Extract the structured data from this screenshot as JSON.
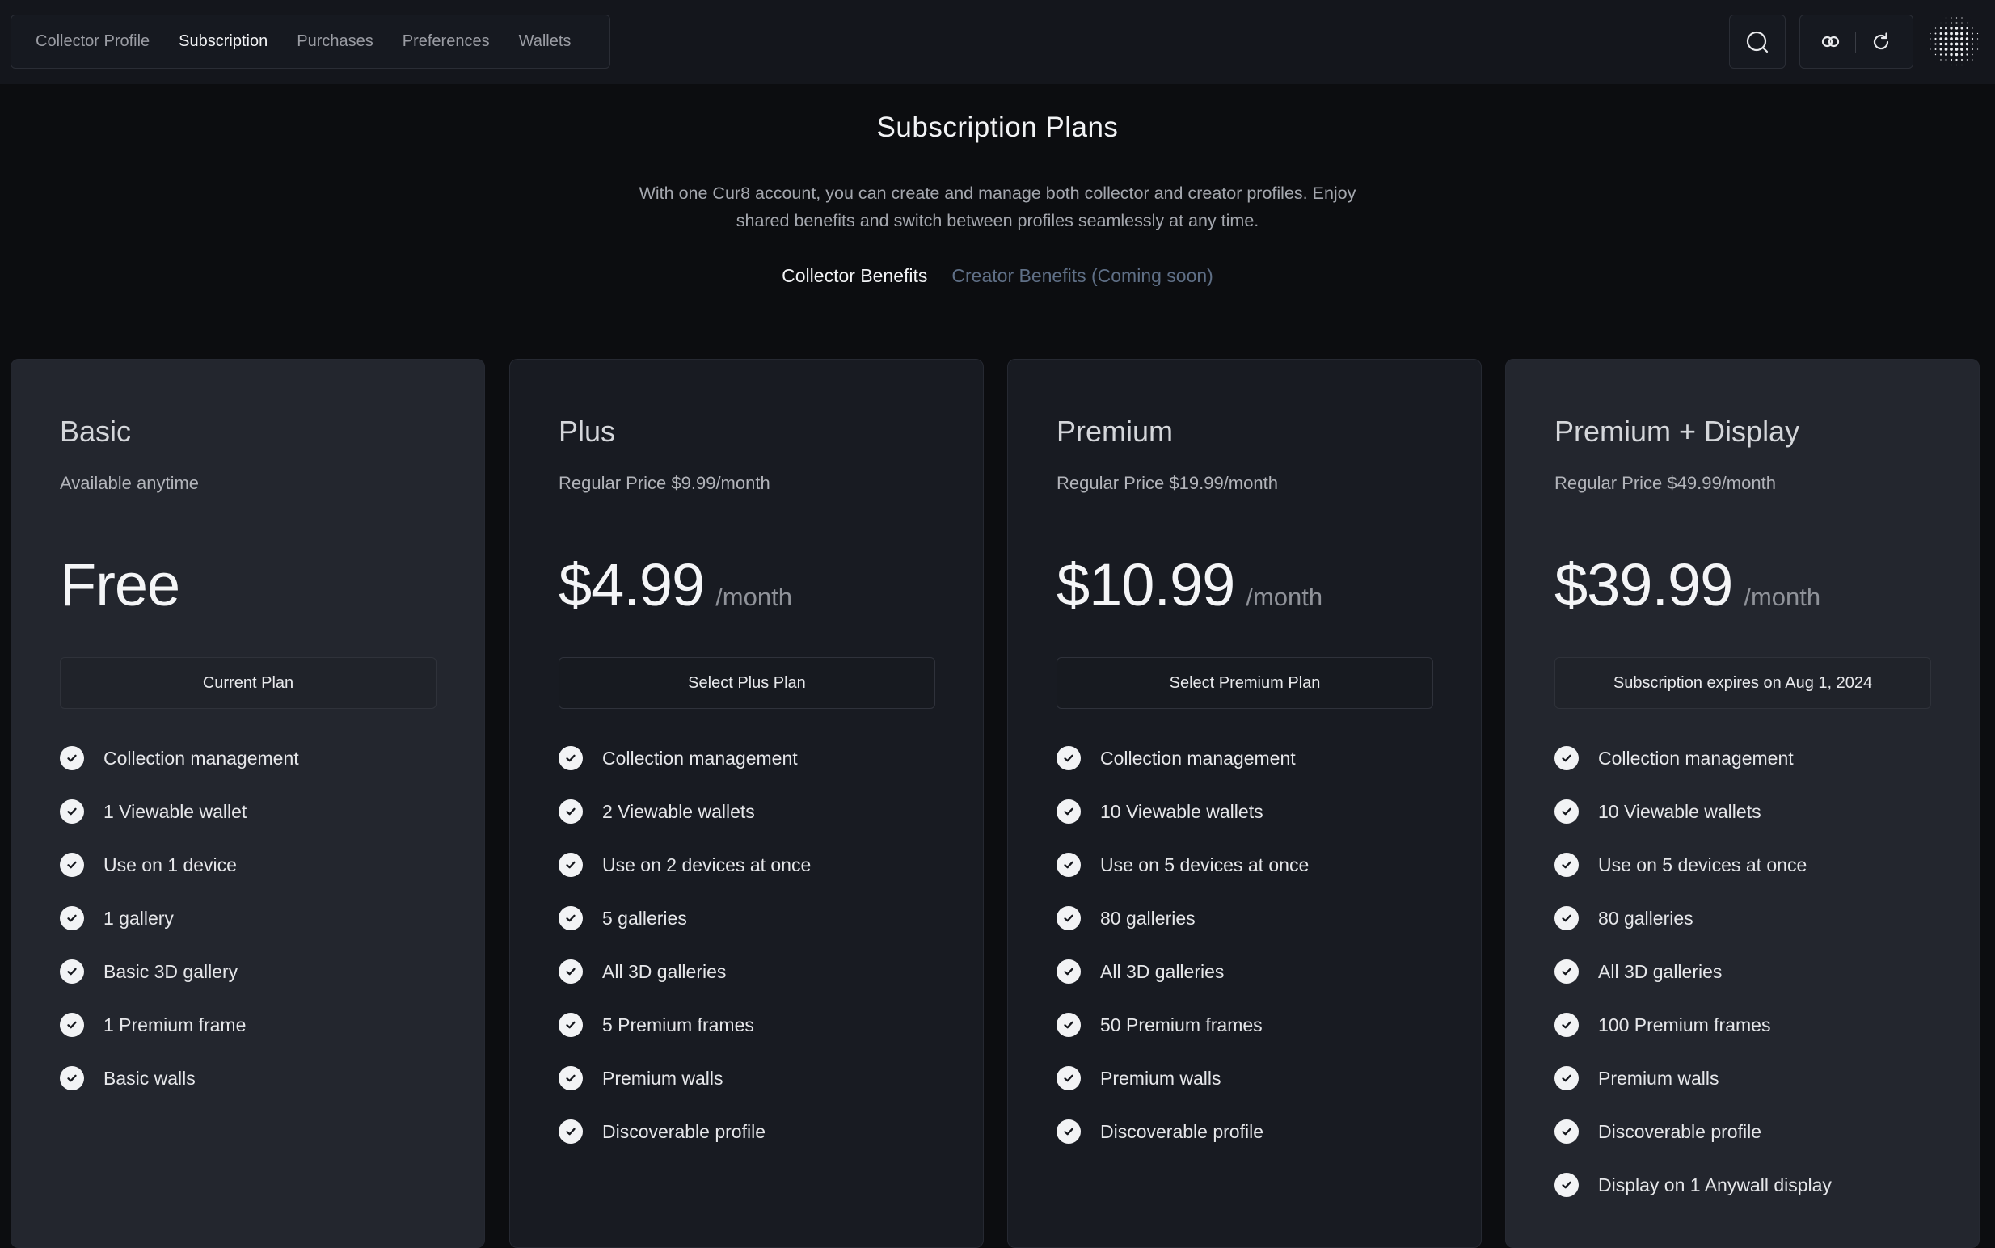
{
  "nav": {
    "tabs": [
      {
        "label": "Collector Profile",
        "active": false
      },
      {
        "label": "Subscription",
        "active": true
      },
      {
        "label": "Purchases",
        "active": false
      },
      {
        "label": "Preferences",
        "active": false
      },
      {
        "label": "Wallets",
        "active": false
      }
    ]
  },
  "header_icons": {
    "search": "search-icon",
    "link": "link-icon",
    "refresh": "refresh-icon",
    "avatar": "dot-pattern-avatar"
  },
  "intro": {
    "title": "Subscription Plans",
    "subtitle": "With one Cur8 account, you can create and manage both collector and creator profiles. Enjoy shared benefits and switch between profiles seamlessly at any time.",
    "benefit_tabs": [
      {
        "label": "Collector Benefits",
        "active": true
      },
      {
        "label": "Creator Benefits (Coming soon)",
        "active": false
      }
    ]
  },
  "plans": [
    {
      "name": "Basic",
      "note": "Available anytime",
      "price": "Free",
      "period": "",
      "button": "Current Plan",
      "features": [
        "Collection management",
        "1 Viewable wallet",
        "Use on 1 device",
        "1 gallery",
        "Basic 3D gallery",
        "1 Premium frame",
        "Basic walls"
      ]
    },
    {
      "name": "Plus",
      "note": "Regular Price $9.99/month",
      "price": "$4.99",
      "period": "/month",
      "button": "Select Plus Plan",
      "features": [
        "Collection management",
        "2 Viewable wallets",
        "Use on 2 devices at once",
        "5 galleries",
        "All 3D galleries",
        "5 Premium frames",
        "Premium walls",
        "Discoverable profile"
      ]
    },
    {
      "name": "Premium",
      "note": "Regular Price $19.99/month",
      "price": "$10.99",
      "period": "/month",
      "button": "Select Premium Plan",
      "features": [
        "Collection management",
        "10 Viewable wallets",
        "Use on 5 devices at once",
        "80 galleries",
        "All 3D galleries",
        "50 Premium frames",
        "Premium walls",
        "Discoverable profile"
      ]
    },
    {
      "name": "Premium + Display",
      "note": "Regular Price $49.99/month",
      "price": "$39.99",
      "period": "/month",
      "button": "Subscription expires on Aug 1, 2024",
      "features": [
        "Collection management",
        "10 Viewable wallets",
        "Use on 5 devices at once",
        "80 galleries",
        "All 3D galleries",
        "100 Premium frames",
        "Premium walls",
        "Discoverable profile",
        "Display on 1 Anywall display"
      ]
    }
  ],
  "colors": {
    "background": "#0c0d10",
    "header": "#14161c",
    "card_light": "#23262e",
    "card_dark": "#181b22",
    "muted_tab": "#5f6f86"
  }
}
